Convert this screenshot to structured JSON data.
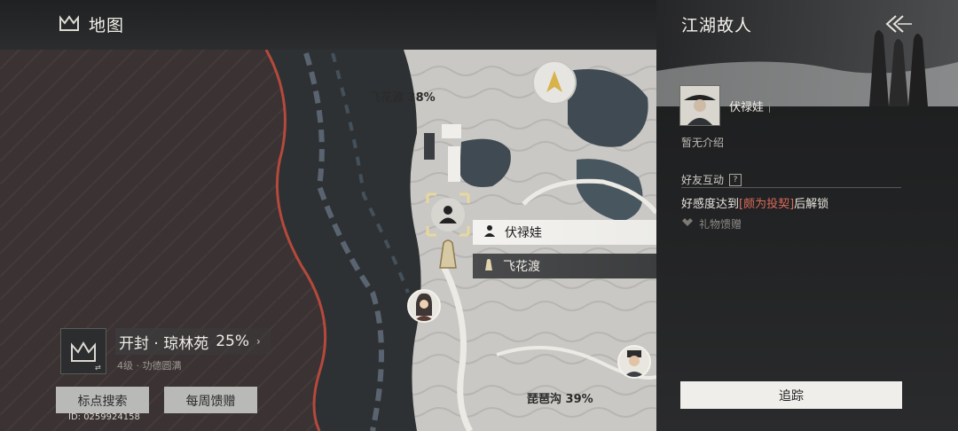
{
  "topbar": {
    "title": "地图"
  },
  "map": {
    "labels": {
      "feihuadu": "飞花渡  38%",
      "pipagou": "琵琶沟  39%"
    },
    "popups": {
      "npc": "伏禄娃",
      "location": "飞花渡"
    }
  },
  "region": {
    "name": "开封 · 琼林苑",
    "percent": "25%",
    "arrow": "›",
    "sub": "4级 · 功德圆满"
  },
  "buttons": {
    "search": "标点搜索",
    "weekly": "每周馈赠"
  },
  "uid": "ID: 0259924158",
  "panel": {
    "title": "江湖故人",
    "npc_name": "伏禄娃",
    "intro": "暂无介绍",
    "section": "好友互动",
    "question": "?",
    "unlock_prefix": "好感度达到",
    "unlock_highlight": "[颇为投契]",
    "unlock_suffix": "后解锁",
    "gift": "礼物馈赠",
    "track": "追踪"
  },
  "colors": {
    "accent_red": "#d96a5a",
    "zone_red": "#b4493c",
    "compass_gold": "#d8b24a"
  }
}
